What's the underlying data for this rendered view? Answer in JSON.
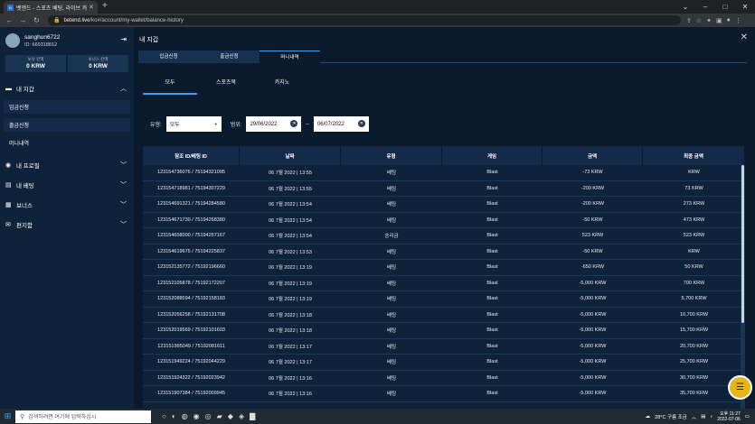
{
  "browser": {
    "tab_title": "벳엔드 - 스포츠 베팅, 라이브 카",
    "url_host": "betend.live",
    "url_path": "/ko#/account/my-wallet/balance-history"
  },
  "sidebar": {
    "username": "sanghun6722",
    "user_id": "ID: 669318812",
    "balances": [
      {
        "label": "보유 잔액",
        "value": "0 KRW"
      },
      {
        "label": "보너스 잔액",
        "value": "0 KRW"
      }
    ],
    "sections": [
      {
        "label": "내 지갑",
        "icon": "wallet-icon"
      },
      {
        "label": "내 프로필",
        "icon": "user-icon"
      },
      {
        "label": "내 베팅",
        "icon": "document-icon"
      },
      {
        "label": "보너스",
        "icon": "gift-icon"
      },
      {
        "label": "편지함",
        "icon": "mail-icon"
      }
    ],
    "wallet_items": [
      "입금신청",
      "출금신청",
      "머니내역"
    ]
  },
  "main": {
    "title": "내 지갑",
    "top_tabs": [
      "입금신청",
      "출금신청",
      "머니내역"
    ],
    "sub_tabs": [
      "모두",
      "스포츠북",
      "카지노"
    ],
    "filter": {
      "type_label": "유형:",
      "type_value": "모두",
      "range_label": "범위:",
      "date_from": "29/06/2022",
      "range_sep": "–",
      "date_to": "06/07/2022"
    },
    "table": {
      "headers": [
        "참조 ID/베팅 ID",
        "날짜",
        "유형",
        "게임",
        "금액",
        "최종 금액"
      ],
      "rows": [
        [
          "123154736076 / 75194321095",
          "06 7월 2022 | 13:55",
          "베팅",
          "Blast",
          "-73 KRW",
          "KRW"
        ],
        [
          "123154718981 / 75194307229",
          "06 7월 2022 | 13:55",
          "베팅",
          "Blast",
          "-200 KRW",
          "73 KRW"
        ],
        [
          "123154691321 / 75194284580",
          "06 7월 2022 | 13:54",
          "베팅",
          "Blast",
          "-200 KRW",
          "273 KRW"
        ],
        [
          "123154671730 / 75194268380",
          "06 7월 2022 | 13:54",
          "베팅",
          "Blast",
          "-50 KRW",
          "473 KRW"
        ],
        [
          "123154658000 / 75194257167",
          "06 7월 2022 | 13:54",
          "승리금",
          "Blast",
          "523 KRW",
          "523 KRW"
        ],
        [
          "123154619675 / 75194225837",
          "06 7월 2022 | 13:53",
          "베팅",
          "Blast",
          "-50 KRW",
          "KRW"
        ],
        [
          "123152135772 / 75192196660",
          "06 7월 2022 | 13:19",
          "베팅",
          "Blast",
          "-650 KRW",
          "50 KRW"
        ],
        [
          "123152105878 / 75192172207",
          "06 7월 2022 | 13:19",
          "베팅",
          "Blast",
          "-5,000 KRW",
          "700 KRW"
        ],
        [
          "123152088594 / 75192158183",
          "06 7월 2022 | 13:19",
          "베팅",
          "Blast",
          "-5,000 KRW",
          "5,700 KRW"
        ],
        [
          "123152056258 / 75192131708",
          "06 7월 2022 | 13:18",
          "베팅",
          "Blast",
          "-5,000 KRW",
          "10,700 KRW"
        ],
        [
          "123152019569 / 75192101603",
          "06 7월 2022 | 13:18",
          "베팅",
          "Blast",
          "-5,000 KRW",
          "15,700 KRW"
        ],
        [
          "123151995049 / 75192081611",
          "06 7월 2022 | 13:17",
          "베팅",
          "Blast",
          "-5,000 KRW",
          "20,700 KRW"
        ],
        [
          "123151949224 / 75192044229",
          "06 7월 2022 | 13:17",
          "베팅",
          "Blast",
          "-5,000 KRW",
          "25,700 KRW"
        ],
        [
          "123151924322 / 75192023942",
          "06 7월 2022 | 13:16",
          "베팅",
          "Blast",
          "-5,000 KRW",
          "30,700 KRW"
        ],
        [
          "123151907384 / 75192009945",
          "06 7월 2022 | 13:16",
          "베팅",
          "Blast",
          "-5,000 KRW",
          "35,700 KRW"
        ]
      ]
    }
  },
  "taskbar": {
    "search_placeholder": "검색하려면 여기에 입력하십시",
    "weather": "28°C 구름 조금",
    "time": "오후 11:27",
    "date": "2022-07-06"
  },
  "colors": {
    "accent": "#3a9ff0",
    "sidebar_bg": "#0e223a",
    "main_bg": "#0b1a2c",
    "chat_button": "#e8b419"
  }
}
